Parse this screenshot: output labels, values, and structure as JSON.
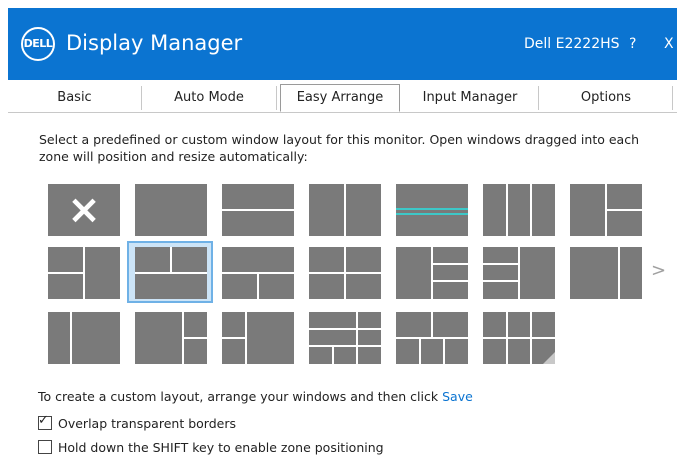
{
  "window": {
    "logo_text": "DELL",
    "title": "Display Manager",
    "monitor": "Dell E2222HS",
    "help_label": "?",
    "close_label": "X"
  },
  "tabs": [
    {
      "label": "Basic",
      "active": false
    },
    {
      "label": "Auto Mode",
      "active": false
    },
    {
      "label": "Easy Arrange",
      "active": true
    },
    {
      "label": "Input Manager",
      "active": false
    },
    {
      "label": "Options",
      "active": false
    }
  ],
  "description": "Select a predefined or custom window layout for this monitor.  Open windows dragged into each zone will position and resize automatically:",
  "layouts": {
    "selected_index": 8,
    "next_arrow": ">",
    "clear_icon": "×"
  },
  "custom_layout": {
    "text": "To create a custom layout, arrange your windows and then click",
    "save_label": "Save"
  },
  "options": [
    {
      "label": "Overlap transparent borders",
      "checked": true
    },
    {
      "label": "Hold down the SHIFT key to enable zone positioning",
      "checked": false
    }
  ],
  "colors": {
    "titlebar": "#0b74d1",
    "tile": "#7a7a7a",
    "selection": "#cce4f7",
    "accent_line": "#3dc8c8",
    "link": "#0b74d1"
  }
}
